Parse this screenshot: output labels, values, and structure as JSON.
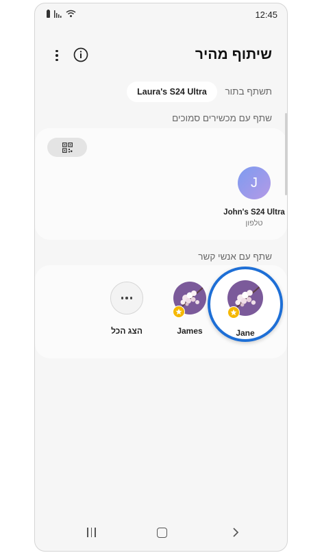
{
  "status_bar": {
    "time": "12:45"
  },
  "header": {
    "title": "שיתוף מהיר"
  },
  "share_to": {
    "label": "תשתף בתור",
    "device": "Laura's S24 Ultra"
  },
  "nearby": {
    "label": "שתף עם מכשירים סמוכים",
    "device": {
      "initial": "J",
      "name": "John's S24 Ultra",
      "type": "טלפון"
    }
  },
  "contacts": {
    "label": "שתף עם אנשי קשר",
    "items": [
      {
        "name": "Jane"
      },
      {
        "name": "James"
      }
    ],
    "show_all_label": "הצג הכל"
  },
  "colors": {
    "highlight": "#1e6fd6",
    "favorite_badge": "#f5b800",
    "avatar_bg": "#7b5a9a"
  }
}
